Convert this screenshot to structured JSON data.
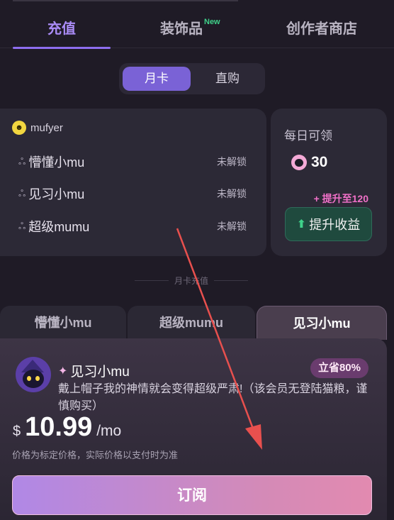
{
  "tabs": {
    "recharge": "充值",
    "decor": "装饰品",
    "decor_badge": "New",
    "creator_shop": "创作者商店"
  },
  "segment": {
    "monthly": "月卡",
    "direct": "直购"
  },
  "membership": {
    "username": "mufyer",
    "tiers": [
      {
        "name": "懵懂小mu",
        "status": "未解锁"
      },
      {
        "name": "见习小mu",
        "status": "未解锁"
      },
      {
        "name": "超级mumu",
        "status": "未解锁"
      }
    ]
  },
  "daily": {
    "label": "每日可领",
    "value": "30",
    "boost_text": "+ 提升至120",
    "boost_button": "提升收益"
  },
  "divider_text": "月卡充值",
  "plan_tabs": [
    "懵懂小mu",
    "超级mumu",
    "见习小mu"
  ],
  "plan": {
    "title": "见习小mu",
    "save_badge": "立省80%",
    "description": "戴上帽子我的神情就会变得超级严肃!（该会员无登陆猫粮，谨慎购买）",
    "currency": "$",
    "price": "10.99",
    "per": "/mo",
    "note": "价格为标定价格，实际价格以支付时为准",
    "subscribe_label": "订阅"
  },
  "colors": {
    "accent": "#8e6ef0",
    "boost_pink": "#f070c8",
    "annotation_arrow": "#e8504e"
  }
}
